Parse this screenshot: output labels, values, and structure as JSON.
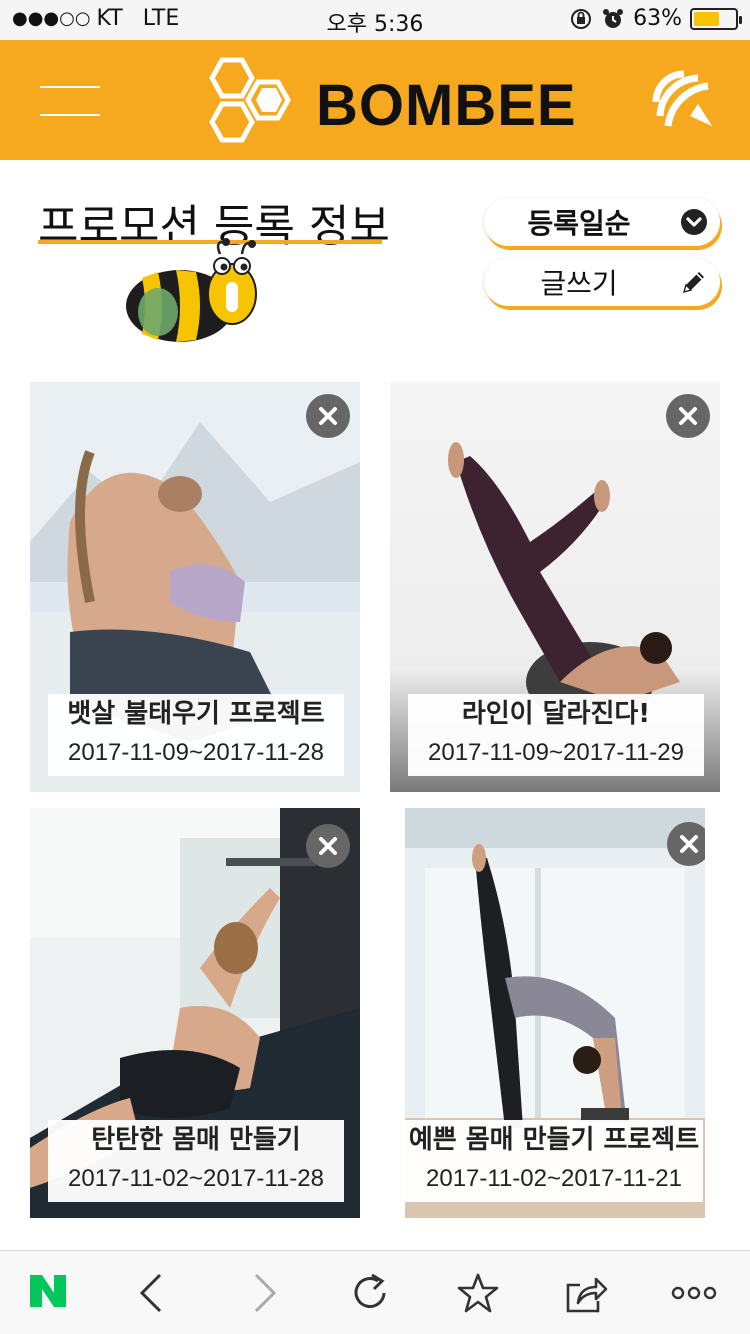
{
  "status_bar": {
    "signal": "●●●○○",
    "carrier": "KT",
    "network": "LTE",
    "time": "오후 5:36",
    "battery_percent": "63%",
    "battery_level": 0.63
  },
  "header": {
    "brand": "BOMBEE",
    "icons": {
      "menu": "hamburger-menu-icon",
      "logo": "honeycomb-logo-icon",
      "rss": "rss-feed-icon"
    },
    "colors": {
      "accent": "#f6a91e"
    }
  },
  "page": {
    "title": "프로모션 등록 정보",
    "sort_label": "등록일순",
    "write_label": "글쓰기"
  },
  "cards": [
    {
      "title": "뱃살 불태우기 프로젝트",
      "date": "2017-11-09~2017-11-28"
    },
    {
      "title": "라인이 달라진다!",
      "date": "2017-11-09~2017-11-29"
    },
    {
      "title": "탄탄한 몸매 만들기",
      "date": "2017-11-02~2017-11-28"
    },
    {
      "title": "예쁜 몸매 만들기 프로젝트",
      "date": "2017-11-02~2017-11-21"
    }
  ],
  "toolbar": {
    "items": [
      "naver-n-icon",
      "back-arrow-icon",
      "forward-arrow-icon",
      "reload-icon",
      "bookmark-star-icon",
      "share-icon",
      "more-dots-icon"
    ],
    "naver_letter": "N"
  }
}
